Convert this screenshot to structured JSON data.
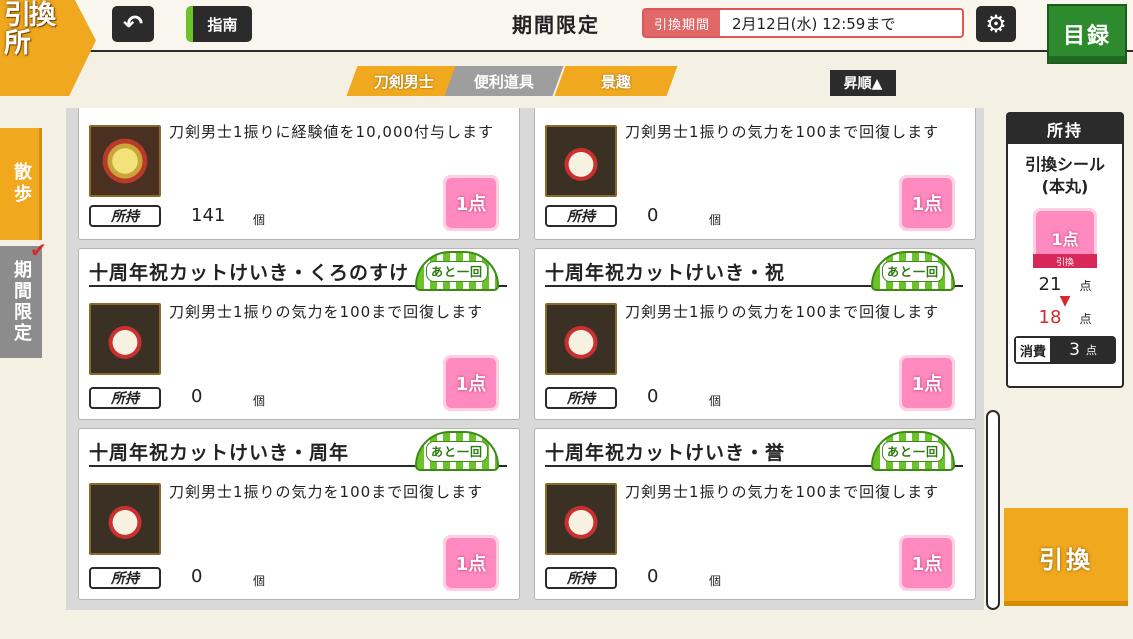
{
  "header": {
    "logo_text": "引換所",
    "back_icon": "↶",
    "guide_label": "指南",
    "title": "期間限定",
    "period_label": "引換期間",
    "period_value": "2月12日(水) 12:59まで",
    "settings_icon": "⚙",
    "catalog_label": "目録"
  },
  "tabs": [
    {
      "label": "刀剣男士",
      "active": true
    },
    {
      "label": "便利道具",
      "active": false
    },
    {
      "label": "景趣",
      "active": false
    }
  ],
  "sort_label": "昇順▲",
  "side_tabs": {
    "walk": "散歩",
    "limited": "期間限定",
    "check": "✔"
  },
  "items": [
    {
      "title": "",
      "desc": "刀剣男士1振りに経験値を10,000付与します",
      "owned_label": "所持",
      "owned": "141",
      "unit": "個",
      "cost": "1点",
      "fan": ""
    },
    {
      "title": "",
      "desc": "刀剣男士1振りの気力を100まで回復します",
      "owned_label": "所持",
      "owned": "0",
      "unit": "個",
      "cost": "1点",
      "fan": ""
    },
    {
      "title": "十周年祝カットけいき・くろのすけ",
      "desc": "刀剣男士1振りの気力を100まで回復します",
      "owned_label": "所持",
      "owned": "0",
      "unit": "個",
      "cost": "1点",
      "fan": "あと一回"
    },
    {
      "title": "十周年祝カットけいき・祝",
      "desc": "刀剣男士1振りの気力を100まで回復します",
      "owned_label": "所持",
      "owned": "0",
      "unit": "個",
      "cost": "1点",
      "fan": "あと一回"
    },
    {
      "title": "十周年祝カットけいき・周年",
      "desc": "刀剣男士1振りの気力を100まで回復します",
      "owned_label": "所持",
      "owned": "0",
      "unit": "個",
      "cost": "1点",
      "fan": "あと一回"
    },
    {
      "title": "十周年祝カットけいき・誉",
      "desc": "刀剣男士1振りの気力を100まで回復します",
      "owned_label": "所持",
      "owned": "0",
      "unit": "個",
      "cost": "1点",
      "fan": "あと一回"
    }
  ],
  "owned_panel": {
    "header": "所持",
    "item_name_1": "引換シール",
    "item_name_2": "(本丸)",
    "seal_value": "1点",
    "seal_tag": "引換",
    "current": "21",
    "after": "18",
    "unit": "点",
    "arrow": "▼",
    "consume_label": "消費",
    "consume_value": "3"
  },
  "exchange_label": "引換",
  "colors": {
    "accent_orange": "#f0a81e",
    "catalog_green": "#2d8a2d",
    "period_red": "#e05555",
    "seal_pink": "#ff8ac0"
  }
}
